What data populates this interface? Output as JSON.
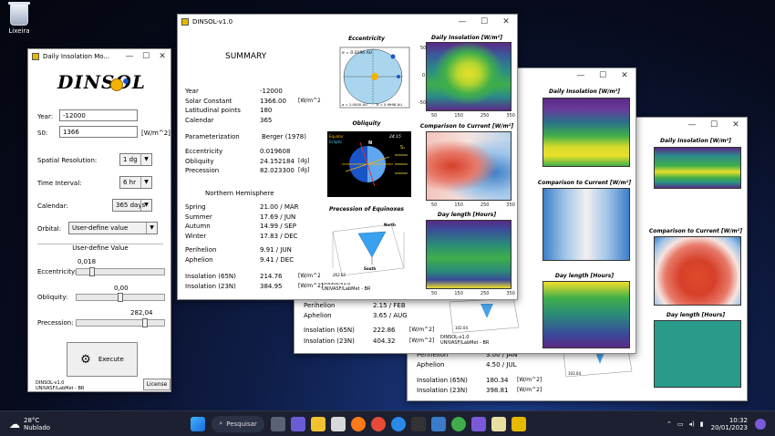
{
  "desktop": {
    "recycle_label": "Lixeira"
  },
  "panel": {
    "title": "Daily Insolation Mo...",
    "logo": "DINSOL",
    "year_label": "Year:",
    "year_value": "-12000",
    "s0_label": "S0:",
    "s0_value": "1366",
    "s0_unit": "[W/m^2]",
    "spatial_label": "Spatial Resolution:",
    "spatial_value": "1  dg",
    "time_label": "Time Interval:",
    "time_value": "6  hr",
    "calendar_label": "Calendar:",
    "calendar_value": "365 days",
    "orbital_label": "Orbital:",
    "orbital_value": "User-define value",
    "user_define_heading": "User-define Value",
    "ecc_label": "Eccentricity:",
    "ecc_value": "0,018",
    "ecc_level": 0.18,
    "obl_label": "Obliquity:",
    "obl_value": "0,00",
    "obl_level": 0.5,
    "prec_label": "Precession:",
    "prec_value": "282,04",
    "prec_level": 0.78,
    "execute_label": "Execute",
    "footer1": "DINSOL-v1.0",
    "footer2": "UNIVASF/LabMet - BR",
    "license_label": "License"
  },
  "main": {
    "title": "DINSOL-v1.0",
    "summary_heading": "SUMMARY",
    "rows": [
      {
        "label": "Year",
        "value": "-12000",
        "unit": ""
      },
      {
        "label": "Solar Constant",
        "value": "1366.00",
        "unit": "[W/m^2]"
      },
      {
        "label": "Latitudinal points",
        "value": "180",
        "unit": ""
      },
      {
        "label": "Calendar",
        "value": "365",
        "unit": ""
      }
    ],
    "param_label": "Parameterization",
    "param_value": "Berger (1978)",
    "orbit_rows": [
      {
        "label": "Eccentricity",
        "value": "0.019608",
        "unit": ""
      },
      {
        "label": "Obliquity",
        "value": "24.152184",
        "unit": "[dg]"
      },
      {
        "label": "Precession",
        "value": "82.023300",
        "unit": "[dg]"
      }
    ],
    "hemisphere": "Northern Hemisphere",
    "season_rows": [
      {
        "label": "Spring",
        "value": "21.00 / MAR"
      },
      {
        "label": "Summer",
        "value": "17.69 / JUN"
      },
      {
        "label": "Autumn",
        "value": "14.99 / SEP"
      },
      {
        "label": "Winter",
        "value": "17.83 / DEC"
      }
    ],
    "peri_rows": [
      {
        "label": "Perihelion",
        "value": "9.91 / JUN"
      },
      {
        "label": "Aphelion",
        "value": "9.41 / DEC"
      }
    ],
    "insol_rows": [
      {
        "label": "Insolation (65N)",
        "value": "214.76",
        "unit": "[W/m^2]"
      },
      {
        "label": "Insolation (23N)",
        "value": "384.95",
        "unit": "[W/m^2]"
      }
    ],
    "plots": {
      "eccentricity_title": "Eccentricity",
      "ecc_e": "e = 0.0196 AU",
      "ecc_a": "a = 1.0000 AU",
      "ecc_b": "b = 0.9998 AU",
      "obliquity_title": "Obliquity",
      "obl_value": "24.15",
      "equator": "Equator",
      "ecliptic": "Ecliptic",
      "precession_title": "Precession of Equinoxes",
      "prec_value": "262.02",
      "north": "North",
      "south": "South",
      "daily_title": "Daily Insolation [W/m²]",
      "comparison_title": "Comparison to Current [W/m²]",
      "daylength_title": "Day length [Hours]",
      "x_ticks": [
        "50",
        "150",
        "250",
        "350"
      ],
      "y_ticks": [
        "50",
        "0",
        "-50"
      ]
    },
    "footer1": "DINSOL-v1.0",
    "footer2": "UNIVASF/LabMet - BR"
  },
  "win2": {
    "peri": "Perihelion",
    "peri_val": "2.15 / FEB",
    "aph": "Aphelion",
    "aph_val": "3.65 / AUG",
    "ins65": "Insolation (65N)",
    "ins65_val": "222.86",
    "ins23": "Insolation (23N)",
    "ins23_val": "404.32",
    "unit": "[W/m^2]",
    "prec_value": "102.04",
    "footer1": "DINSOL-v1.0",
    "footer2": "UNIVASF/LabMet - BR"
  },
  "win3": {
    "peri": "Perihelion",
    "peri_val": "3.00 / JAN",
    "aph": "Aphelion",
    "aph_val": "4.50 / JUL",
    "ins65": "Insolation (65N)",
    "ins65_val": "180.34",
    "ins23": "Insolation (23N)",
    "ins23_val": "398.81",
    "unit": "[W/m^2]",
    "prec_value": "102.04"
  },
  "taskbar": {
    "weather_temp": "28°C",
    "weather_desc": "Nublado",
    "search": "Pesquisar",
    "time": "10:32",
    "date": "20/01/2023"
  }
}
